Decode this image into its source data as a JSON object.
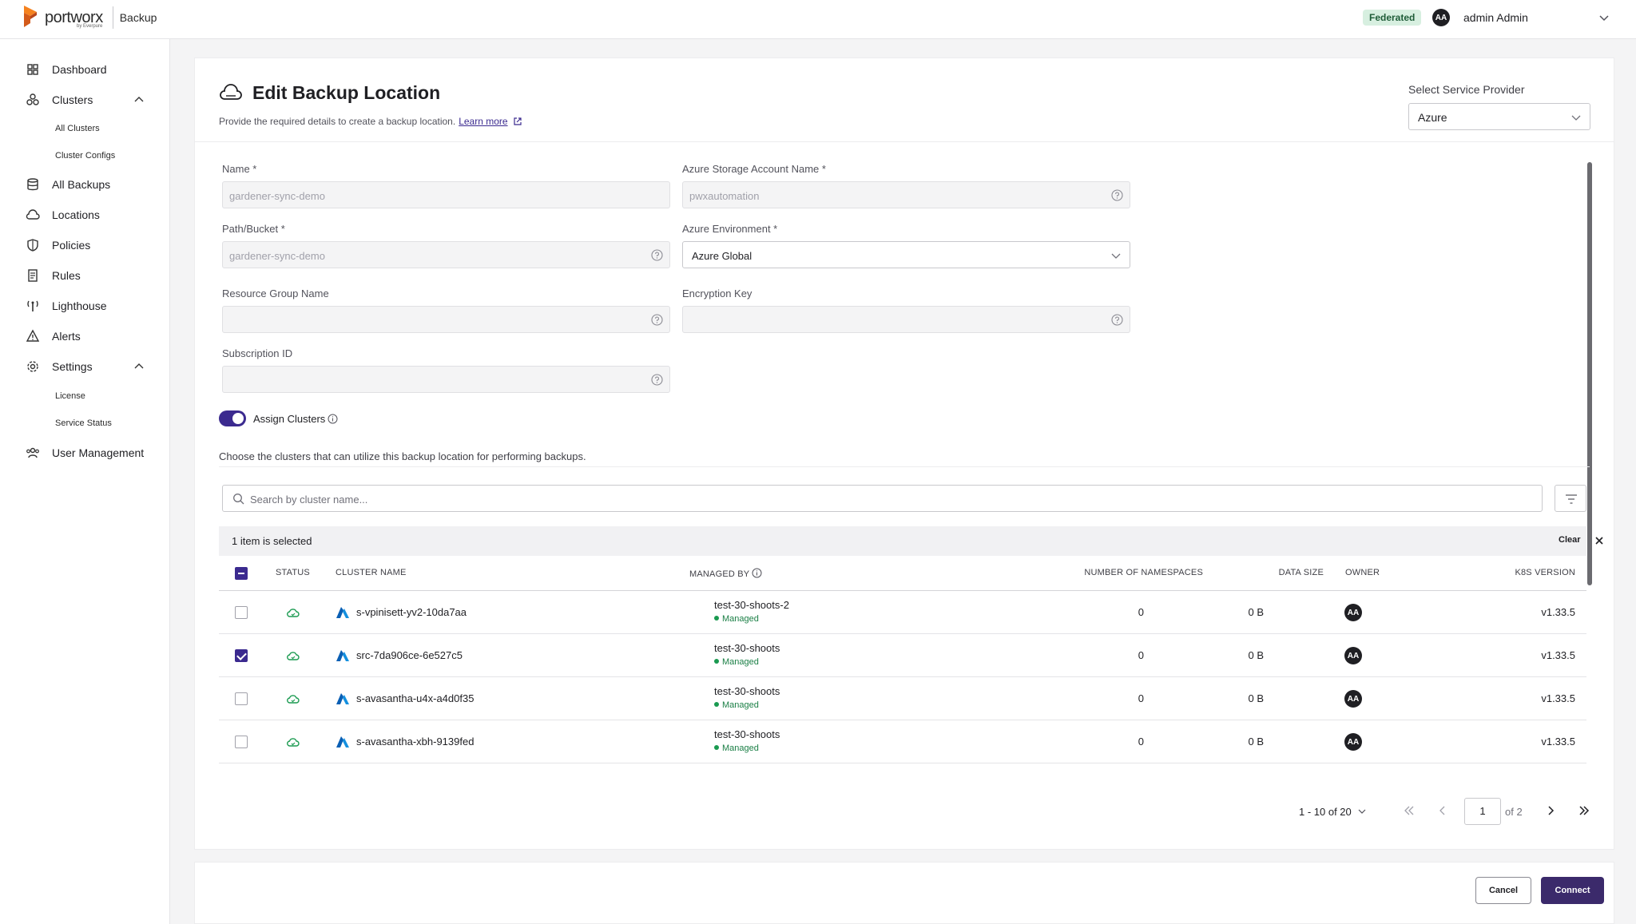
{
  "brand": {
    "name": "portworx",
    "sub": "by Everpure",
    "product": "Backup"
  },
  "header": {
    "badge": "Federated",
    "avatar_initials": "AA",
    "user_name": "admin Admin"
  },
  "sidebar": {
    "items": [
      {
        "label": "Dashboard",
        "icon": "dashboard-icon"
      },
      {
        "label": "Clusters",
        "icon": "clusters-icon"
      },
      {
        "label": "All Backups",
        "icon": "backups-icon"
      },
      {
        "label": "Locations",
        "icon": "cloud-icon"
      },
      {
        "label": "Policies",
        "icon": "shield-icon"
      },
      {
        "label": "Rules",
        "icon": "rules-icon"
      },
      {
        "label": "Lighthouse",
        "icon": "lighthouse-icon"
      },
      {
        "label": "Alerts",
        "icon": "alert-icon"
      },
      {
        "label": "Settings",
        "icon": "gear-icon"
      },
      {
        "label": "User Management",
        "icon": "users-icon"
      }
    ],
    "clusters_sub": [
      "All Clusters",
      "Cluster Configs"
    ],
    "settings_sub": [
      "License",
      "Service Status"
    ]
  },
  "page": {
    "title": "Edit Backup Location",
    "subtitle": "Provide the required details to create a backup location.",
    "learn_more": "Learn more",
    "service_provider_label": "Select Service Provider",
    "service_provider_value": "Azure"
  },
  "form": {
    "name_label": "Name *",
    "name_value": "gardener-sync-demo",
    "account_label": "Azure Storage Account Name *",
    "account_value": "pwxautomation",
    "path_label": "Path/Bucket *",
    "path_value": "gardener-sync-demo",
    "env_label": "Azure Environment *",
    "env_value": "Azure Global",
    "rg_label": "Resource Group Name",
    "rg_value": "",
    "enc_label": "Encryption Key",
    "enc_value": "",
    "sub_label": "Subscription ID",
    "sub_value": ""
  },
  "assign": {
    "toggle_on": true,
    "label": "Assign Clusters",
    "description": "Choose the clusters that can utilize this backup location for performing backups."
  },
  "clusters_table": {
    "search_placeholder": "Search by cluster name...",
    "selection_text": "1 item is selected",
    "clear_label": "Clear",
    "headers": {
      "status": "STATUS",
      "name": "CLUSTER NAME",
      "managed_by": "MANAGED BY",
      "namespaces": "NUMBER OF NAMESPACES",
      "data_size": "DATA SIZE",
      "owner": "OWNER",
      "k8s": "K8S VERSION"
    },
    "rows": [
      {
        "checked": false,
        "name": "s-vpinisett-yv2-10da7aa",
        "managed_by": "test-30-shoots-2",
        "managed_status": "Managed",
        "namespaces": "0",
        "data_size": "0 B",
        "owner": "AA",
        "k8s": "v1.33.5"
      },
      {
        "checked": true,
        "name": "src-7da906ce-6e527c5",
        "managed_by": "test-30-shoots",
        "managed_status": "Managed",
        "namespaces": "0",
        "data_size": "0 B",
        "owner": "AA",
        "k8s": "v1.33.5"
      },
      {
        "checked": false,
        "name": "s-avasantha-u4x-a4d0f35",
        "managed_by": "test-30-shoots",
        "managed_status": "Managed",
        "namespaces": "0",
        "data_size": "0 B",
        "owner": "AA",
        "k8s": "v1.33.5"
      },
      {
        "checked": false,
        "name": "s-avasantha-xbh-9139fed",
        "managed_by": "test-30-shoots",
        "managed_status": "Managed",
        "namespaces": "0",
        "data_size": "0 B",
        "owner": "AA",
        "k8s": "v1.33.5"
      }
    ]
  },
  "pagination": {
    "range": "1 - 10 of 20",
    "page": "1",
    "of": "of 2"
  },
  "footer": {
    "cancel": "Cancel",
    "connect": "Connect"
  },
  "colors": {
    "accent": "#3b2a8f",
    "managed": "#1a7f45",
    "badge_bg": "#d7efe0"
  }
}
